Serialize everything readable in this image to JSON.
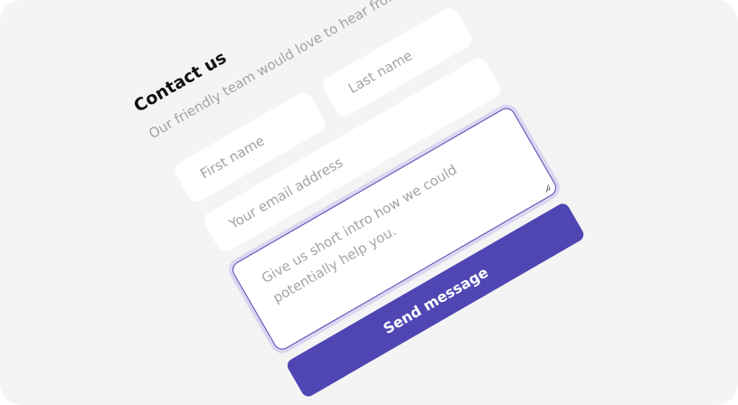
{
  "form": {
    "title": "Contact us",
    "subtitle": "Our friendly team would love to hear from you",
    "first_name_placeholder": "First name",
    "last_name_placeholder": "Last name",
    "email_placeholder": "Your email address",
    "message_placeholder": "Give us short intro how we could potentially help you.",
    "send_label": "Send message"
  },
  "colors": {
    "accent": "#4f46b4",
    "background": "#f4f4f4",
    "placeholder": "#a3a3a3"
  }
}
